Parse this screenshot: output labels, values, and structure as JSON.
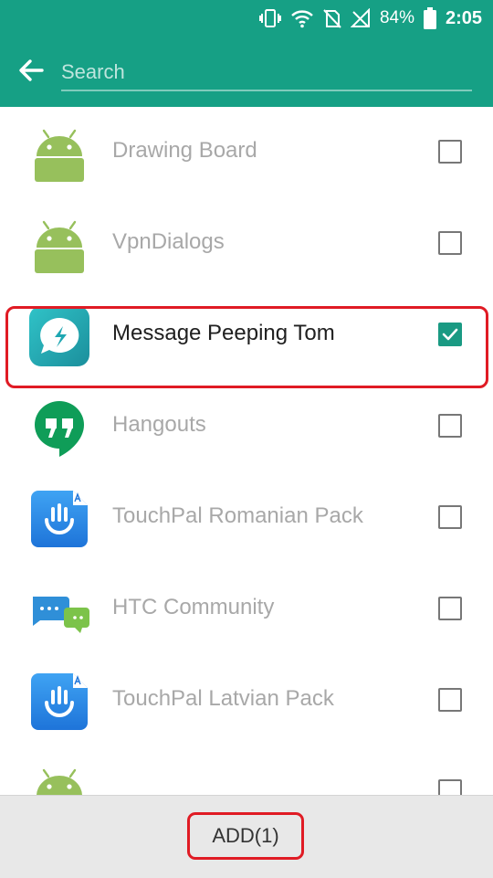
{
  "status_bar": {
    "battery_text": "84%",
    "time": "2:05",
    "icons": [
      "vibrate-icon",
      "wifi-icon",
      "no-sim-icon",
      "signal-icon",
      "battery-icon"
    ]
  },
  "toolbar": {
    "back_icon": "arrow-back-icon",
    "search_placeholder": "Search",
    "color": "#16a085"
  },
  "apps": [
    {
      "name": "Drawing Board",
      "icon": "android-robot-icon",
      "checked": false
    },
    {
      "name": "VpnDialogs",
      "icon": "android-robot-icon",
      "checked": false
    },
    {
      "name": "Message Peeping Tom",
      "icon": "message-peeping-tom-icon",
      "checked": true
    },
    {
      "name": "Hangouts",
      "icon": "hangouts-icon",
      "checked": false
    },
    {
      "name": "TouchPal Romanian Pack",
      "icon": "touchpal-icon",
      "checked": false
    },
    {
      "name": "HTC Community",
      "icon": "htc-community-icon",
      "checked": false
    },
    {
      "name": "TouchPal Latvian Pack",
      "icon": "touchpal-icon",
      "checked": false
    },
    {
      "name": "",
      "icon": "android-robot-icon",
      "checked": false
    }
  ],
  "footer": {
    "add_label": "ADD(1)"
  },
  "colors": {
    "accent": "#16a085",
    "checked": "#1a9a83",
    "highlight": "#e01b24"
  }
}
